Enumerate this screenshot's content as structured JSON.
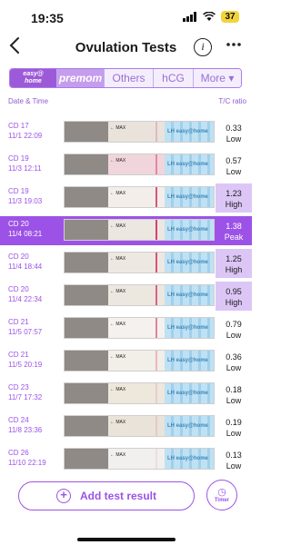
{
  "status_bar": {
    "time": "19:35",
    "battery": "37",
    "signal_icon": "signal-icon",
    "wifi_icon": "wifi-icon"
  },
  "nav": {
    "title": "Ovulation Tests",
    "back_icon": "chevron-left-icon",
    "info_icon": "info-icon",
    "more_icon": "ellipsis-icon"
  },
  "tabs": {
    "easy_top": "easy@",
    "easy_bottom": "home",
    "premom": "premom",
    "others": "Others",
    "hcg": "hCG",
    "more": "More ▾"
  },
  "columns": {
    "date": "Date & Time",
    "ratio": "T/C ratio"
  },
  "strip_label": "← MAX",
  "strip_brand": "LH  easy@home",
  "tests": [
    {
      "cd": "CD 17",
      "date": "11/1 22:09",
      "ratio": "0.33",
      "level": "Low",
      "highlight": false,
      "peak": false,
      "line_intensity": 0.25,
      "tone": "#e9e3dc"
    },
    {
      "cd": "CD 19",
      "date": "11/3 12:11",
      "ratio": "0.57",
      "level": "Low",
      "highlight": false,
      "peak": false,
      "line_intensity": 0.5,
      "tone": "#f0d6dc"
    },
    {
      "cd": "CD 19",
      "date": "11/3 19:03",
      "ratio": "1.23",
      "level": "High",
      "highlight": true,
      "peak": false,
      "line_intensity": 0.85,
      "tone": "#f3eeea"
    },
    {
      "cd": "CD 20",
      "date": "11/4 08:21",
      "ratio": "1.38",
      "level": "Peak",
      "highlight": true,
      "peak": true,
      "line_intensity": 0.95,
      "tone": "#ece7e0"
    },
    {
      "cd": "CD 20",
      "date": "11/4 18:44",
      "ratio": "1.25",
      "level": "High",
      "highlight": true,
      "peak": false,
      "line_intensity": 0.85,
      "tone": "#ede8e1"
    },
    {
      "cd": "CD 20",
      "date": "11/4 22:34",
      "ratio": "0.95",
      "level": "High",
      "highlight": true,
      "peak": false,
      "line_intensity": 0.75,
      "tone": "#ece7df"
    },
    {
      "cd": "CD 21",
      "date": "11/5 07:57",
      "ratio": "0.79",
      "level": "Low",
      "highlight": false,
      "peak": false,
      "line_intensity": 0.6,
      "tone": "#f4f1ee"
    },
    {
      "cd": "CD 21",
      "date": "11/5 20:19",
      "ratio": "0.36",
      "level": "Low",
      "highlight": false,
      "peak": false,
      "line_intensity": 0.3,
      "tone": "#f2eee8"
    },
    {
      "cd": "CD 23",
      "date": "11/7 17:32",
      "ratio": "0.18",
      "level": "Low",
      "highlight": false,
      "peak": false,
      "line_intensity": 0.15,
      "tone": "#ede7dc"
    },
    {
      "cd": "CD 24",
      "date": "11/8 23:36",
      "ratio": "0.19",
      "level": "Low",
      "highlight": false,
      "peak": false,
      "line_intensity": 0.15,
      "tone": "#e9e3d9"
    },
    {
      "cd": "CD 26",
      "date": "11/10 22:19",
      "ratio": "0.13",
      "level": "Low",
      "highlight": false,
      "peak": false,
      "line_intensity": 0.1,
      "tone": "#f1f0ee"
    }
  ],
  "footer": {
    "add_label": "Add test result",
    "timer_label": "Timer",
    "plus_icon": "plus-circle-icon",
    "timer_icon": "clock-icon"
  },
  "colors": {
    "accent": "#9c52e6",
    "highlight": "#dcc6f6",
    "line": "#d2386a",
    "control": "#b8244c"
  }
}
